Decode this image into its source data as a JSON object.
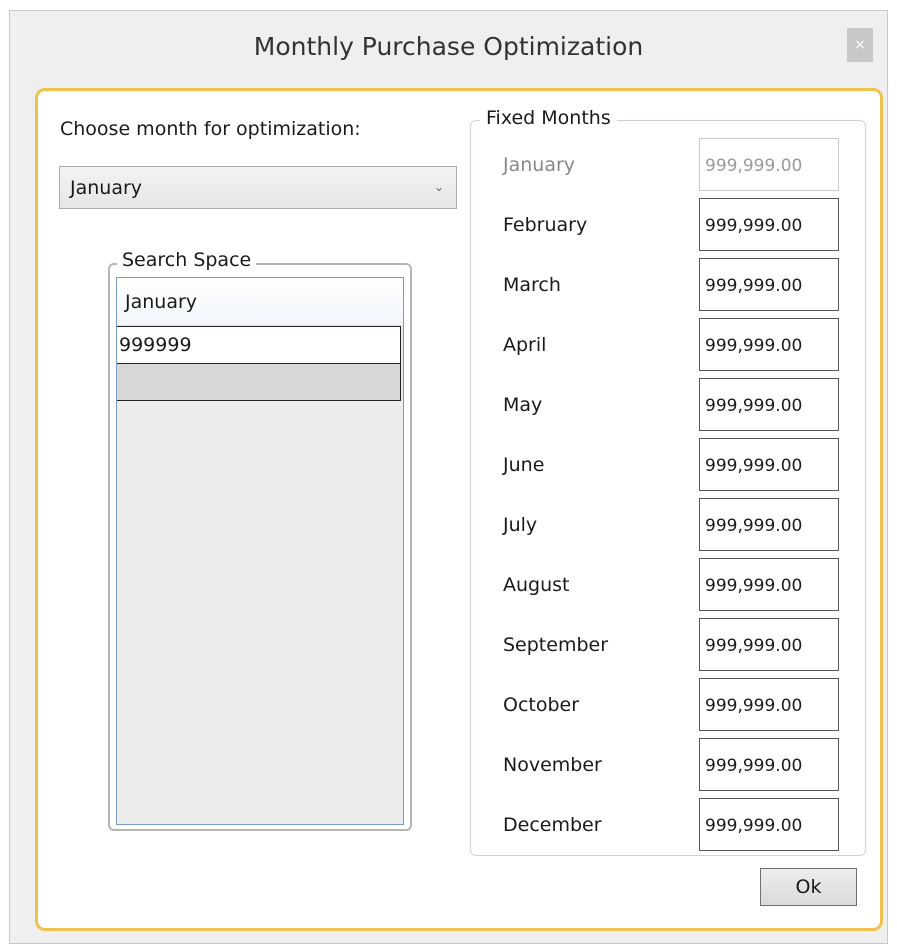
{
  "window": {
    "title": "Monthly Purchase Optimization",
    "close_glyph": "×"
  },
  "month_selector": {
    "label": "Choose month for optimization:",
    "selected": "January",
    "arrow_glyph": "⌄"
  },
  "search_space": {
    "legend": "Search Space",
    "column_header": "January",
    "rows": [
      "999999",
      ""
    ]
  },
  "fixed_months": {
    "legend": "Fixed Months",
    "months": [
      {
        "name": "January",
        "value": "999,999.00",
        "disabled": true
      },
      {
        "name": "February",
        "value": "999,999.00",
        "disabled": false
      },
      {
        "name": "March",
        "value": "999,999.00",
        "disabled": false
      },
      {
        "name": "April",
        "value": "999,999.00",
        "disabled": false
      },
      {
        "name": "May",
        "value": "999,999.00",
        "disabled": false
      },
      {
        "name": "June",
        "value": "999,999.00",
        "disabled": false
      },
      {
        "name": "July",
        "value": "999,999.00",
        "disabled": false
      },
      {
        "name": "August",
        "value": "999,999.00",
        "disabled": false
      },
      {
        "name": "September",
        "value": "999,999.00",
        "disabled": false
      },
      {
        "name": "October",
        "value": "999,999.00",
        "disabled": false
      },
      {
        "name": "November",
        "value": "999,999.00",
        "disabled": false
      },
      {
        "name": "December",
        "value": "999,999.00",
        "disabled": false
      }
    ]
  },
  "ok_button": {
    "label": "Ok"
  },
  "colors": {
    "frame_accent": "#f0c24d",
    "grid_border": "#7a9cc6",
    "window_bg": "#efefef"
  }
}
